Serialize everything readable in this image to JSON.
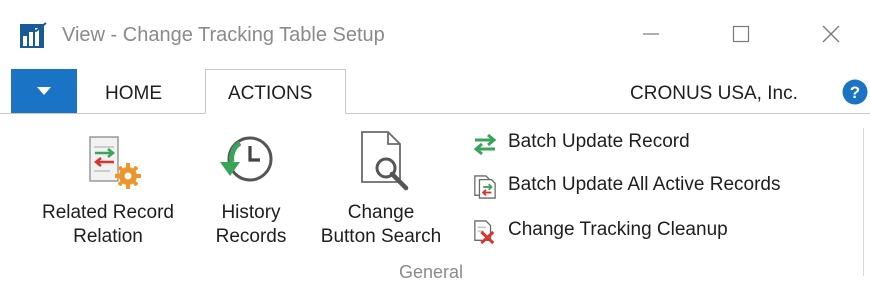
{
  "window": {
    "title": "View - Change Tracking Table Setup",
    "controls": [
      "minimize-icon",
      "maximize-icon",
      "close-icon"
    ]
  },
  "tabs": {
    "file_menu_icon": "dropdown-arrow-icon",
    "items": [
      {
        "label": "HOME",
        "active": false
      },
      {
        "label": "ACTIONS",
        "active": true
      }
    ],
    "company": "CRONUS USA, Inc."
  },
  "ribbon": {
    "group": "General",
    "large_actions": [
      {
        "label_line1": "Related Record",
        "label_line2": "Relation",
        "icon": "related-record-relation-icon"
      },
      {
        "label_line1": "History",
        "label_line2": "Records",
        "icon": "history-clock-icon"
      },
      {
        "label_line1": "Change",
        "label_line2": "Button Search",
        "icon": "document-search-icon"
      }
    ],
    "small_actions": [
      {
        "label": "Batch Update Record",
        "icon": "swap-arrows-icon"
      },
      {
        "label": "Batch Update All Active Records",
        "icon": "documents-swap-icon"
      },
      {
        "label": "Change Tracking Cleanup",
        "icon": "document-delete-icon"
      }
    ]
  },
  "colors": {
    "accent": "#1a73c4",
    "green": "#3aa35a",
    "orange": "#f0952b",
    "red": "#d9342b",
    "muted_text": "#8a8a8a"
  }
}
